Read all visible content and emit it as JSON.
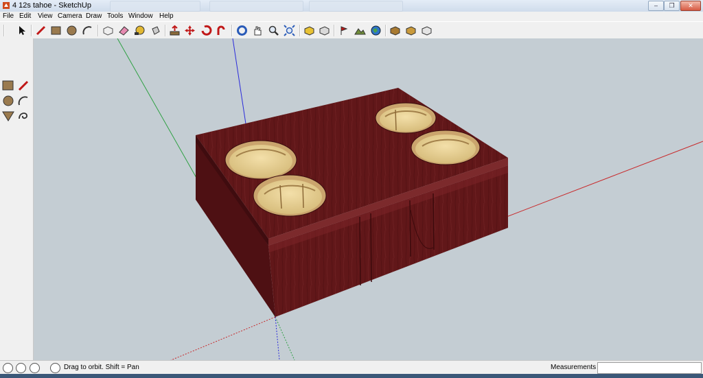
{
  "window": {
    "title": "4 12s tahoe - SketchUp"
  },
  "menu": [
    "File",
    "Edit",
    "View",
    "Camera",
    "Draw",
    "Tools",
    "Window",
    "Help"
  ],
  "toolbar": [
    "select-icon",
    "line-icon",
    "rectangle-icon",
    "circle-icon",
    "arc-icon",
    "make-component-icon",
    "eraser-icon",
    "tape-measure-icon",
    "paint-bucket-icon",
    "push-pull-icon",
    "move-icon",
    "rotate-icon",
    "follow-me-icon",
    "orbit-icon",
    "pan-icon",
    "zoom-icon",
    "zoom-extents-icon",
    "get-models-icon",
    "share-model-icon",
    "add-location-icon",
    "toggle-terrain-icon",
    "google-earth-icon",
    "get-photo-texture-icon",
    "component-icon",
    "share-component-icon"
  ],
  "status": {
    "hint": "Drag to orbit.  Shift = Pan",
    "measurements_label": "Measurements",
    "measurements_value": ""
  },
  "colors": {
    "wood_top": "#63181a",
    "wood_side": "#5a1216",
    "axis_red": "#c8282a",
    "axis_green": "#2ea043",
    "axis_blue": "#2a2adb"
  }
}
